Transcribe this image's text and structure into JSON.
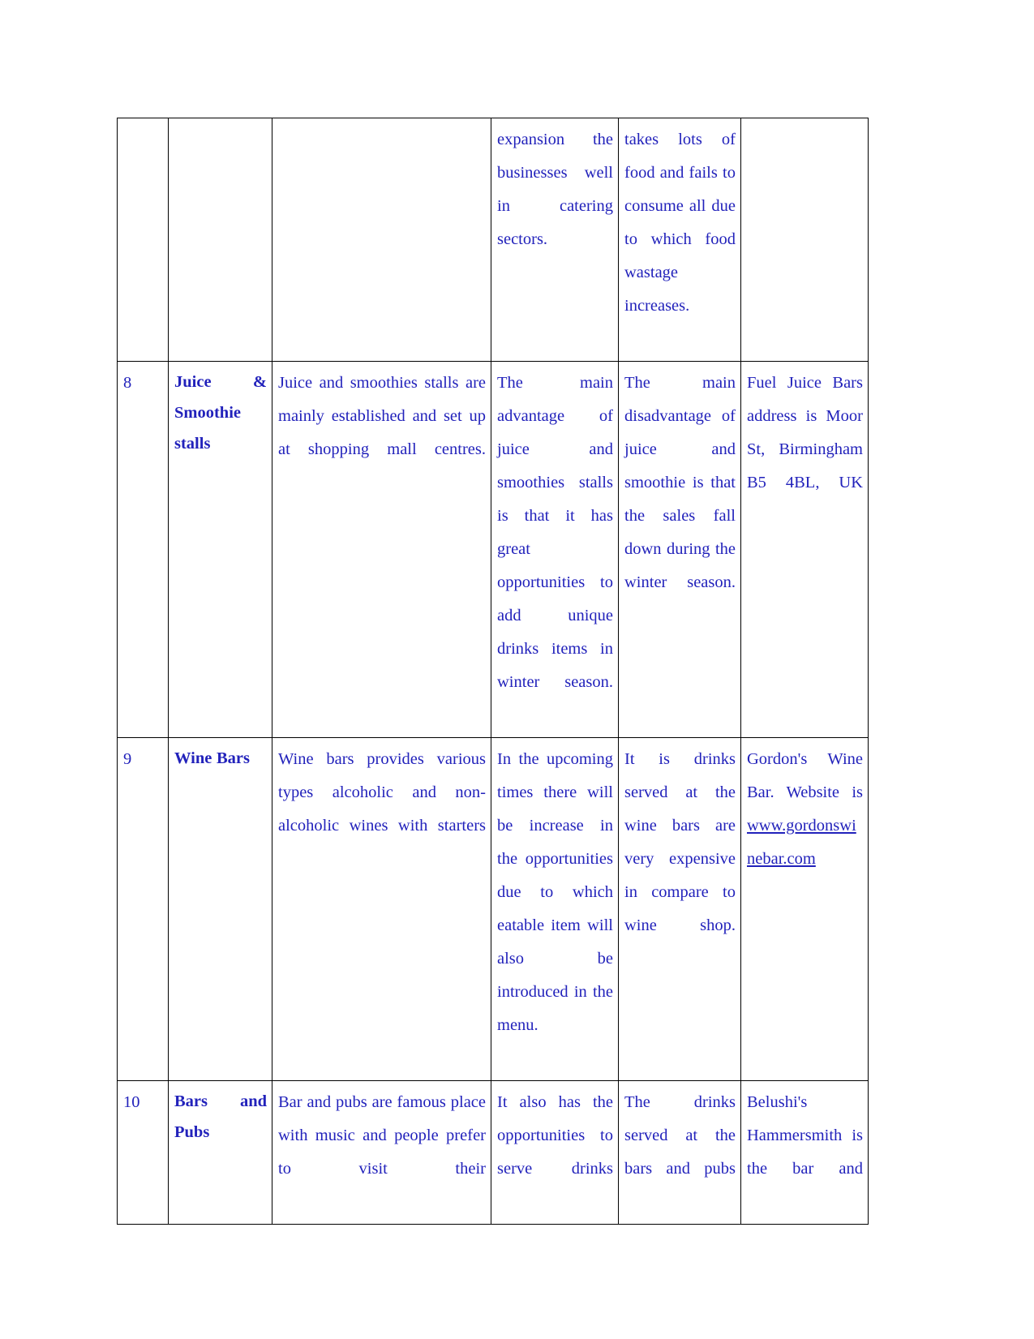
{
  "document": {
    "text_color": "#2222BB",
    "border_color": "#000000",
    "background": "#ffffff"
  },
  "table": {
    "continued_row": {
      "col1": "",
      "col2": "",
      "col3": "",
      "col4": "expansion the businesses well in catering sectors.",
      "col5": "takes lots of food and fails to consume all due to which food wastage increases.",
      "col6": ""
    },
    "rows": [
      {
        "number": "8",
        "name": "Juice & Smoothie stalls",
        "description": "Juice and smoothies stalls are mainly established and set up at shopping mall centres.",
        "advantage": "The main advantage of juice and smoothies stalls is that it has great opportunities to add unique drinks items in winter season.",
        "disadvantage": "The main disadvantage of juice and smoothie is that the sales fall down during the winter season.",
        "example": "Fuel Juice Bars address is Moor St, Birmingham B5 4BL, UK",
        "example_link": "",
        "example_link_text": ""
      },
      {
        "number": "9",
        "name": "Wine Bars",
        "description": "Wine bars provides various types alcoholic and non- alcoholic wines with starters",
        "advantage": "In the upcoming times there will be increase in the opportunities due to which eatable item will also be introduced in the menu.",
        "disadvantage": "It is drinks served at the wine bars are very expensive in compare to wine shop.",
        "example": "Gordon's Wine Bar. Website is ",
        "example_link_text": "www.gordonswinebar.com"
      },
      {
        "number": "10",
        "name": "Bars and Pubs",
        "description": "Bar and pubs are famous place with music and people prefer to visit their",
        "advantage": "It also has the opportunities to serve drinks",
        "disadvantage": "The drinks served at the bars and pubs",
        "example": "Belushi's Hammersmith is the bar and",
        "example_link_text": ""
      }
    ]
  }
}
